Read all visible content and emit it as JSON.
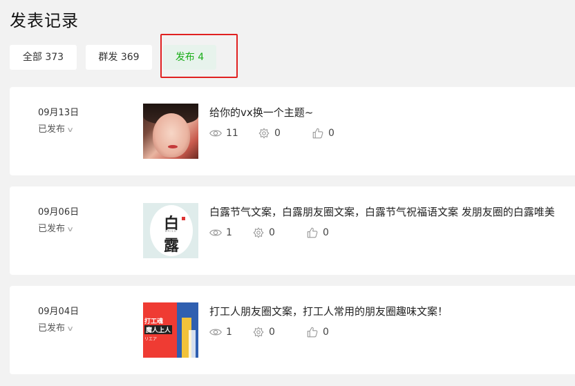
{
  "page": {
    "title": "发表记录"
  },
  "tabs": [
    {
      "label": "全部 373",
      "active": false
    },
    {
      "label": "群发 369",
      "active": false
    },
    {
      "label": "发布 4",
      "active": true
    }
  ],
  "colors": {
    "accent": "#1aad19",
    "highlight": "#e02020",
    "background": "#f2f2f2"
  },
  "records": [
    {
      "date": "09月13日",
      "status": "已发布",
      "title": "给你的vx换一个主题~",
      "views": "11",
      "shares": "0",
      "likes": "0",
      "thumb_icon": "portrait-photo"
    },
    {
      "date": "09月06日",
      "status": "已发布",
      "title": "白露节气文案，白露朋友圈文案，白露节气祝福语文案 发朋友圈的白露唯美",
      "views": "1",
      "shares": "0",
      "likes": "0",
      "thumb_icon": "bailu-cover",
      "thumb_text": {
        "char1": "白",
        "char2": "露",
        "en": "BAILU"
      }
    },
    {
      "date": "09月04日",
      "status": "已发布",
      "title": "打工人朋友圈文案，打工人常用的朋友圈趣味文案！",
      "views": "1",
      "shares": "0",
      "likes": "0",
      "thumb_icon": "worker-cover",
      "thumb_text": {
        "line1": "打工魂",
        "line2": "魔人上人",
        "line3": "リエア"
      }
    }
  ],
  "icons": {
    "views": "eye-icon",
    "shares": "share-gear-icon",
    "likes": "thumbs-up-icon",
    "expand": "chevron-down-icon"
  }
}
